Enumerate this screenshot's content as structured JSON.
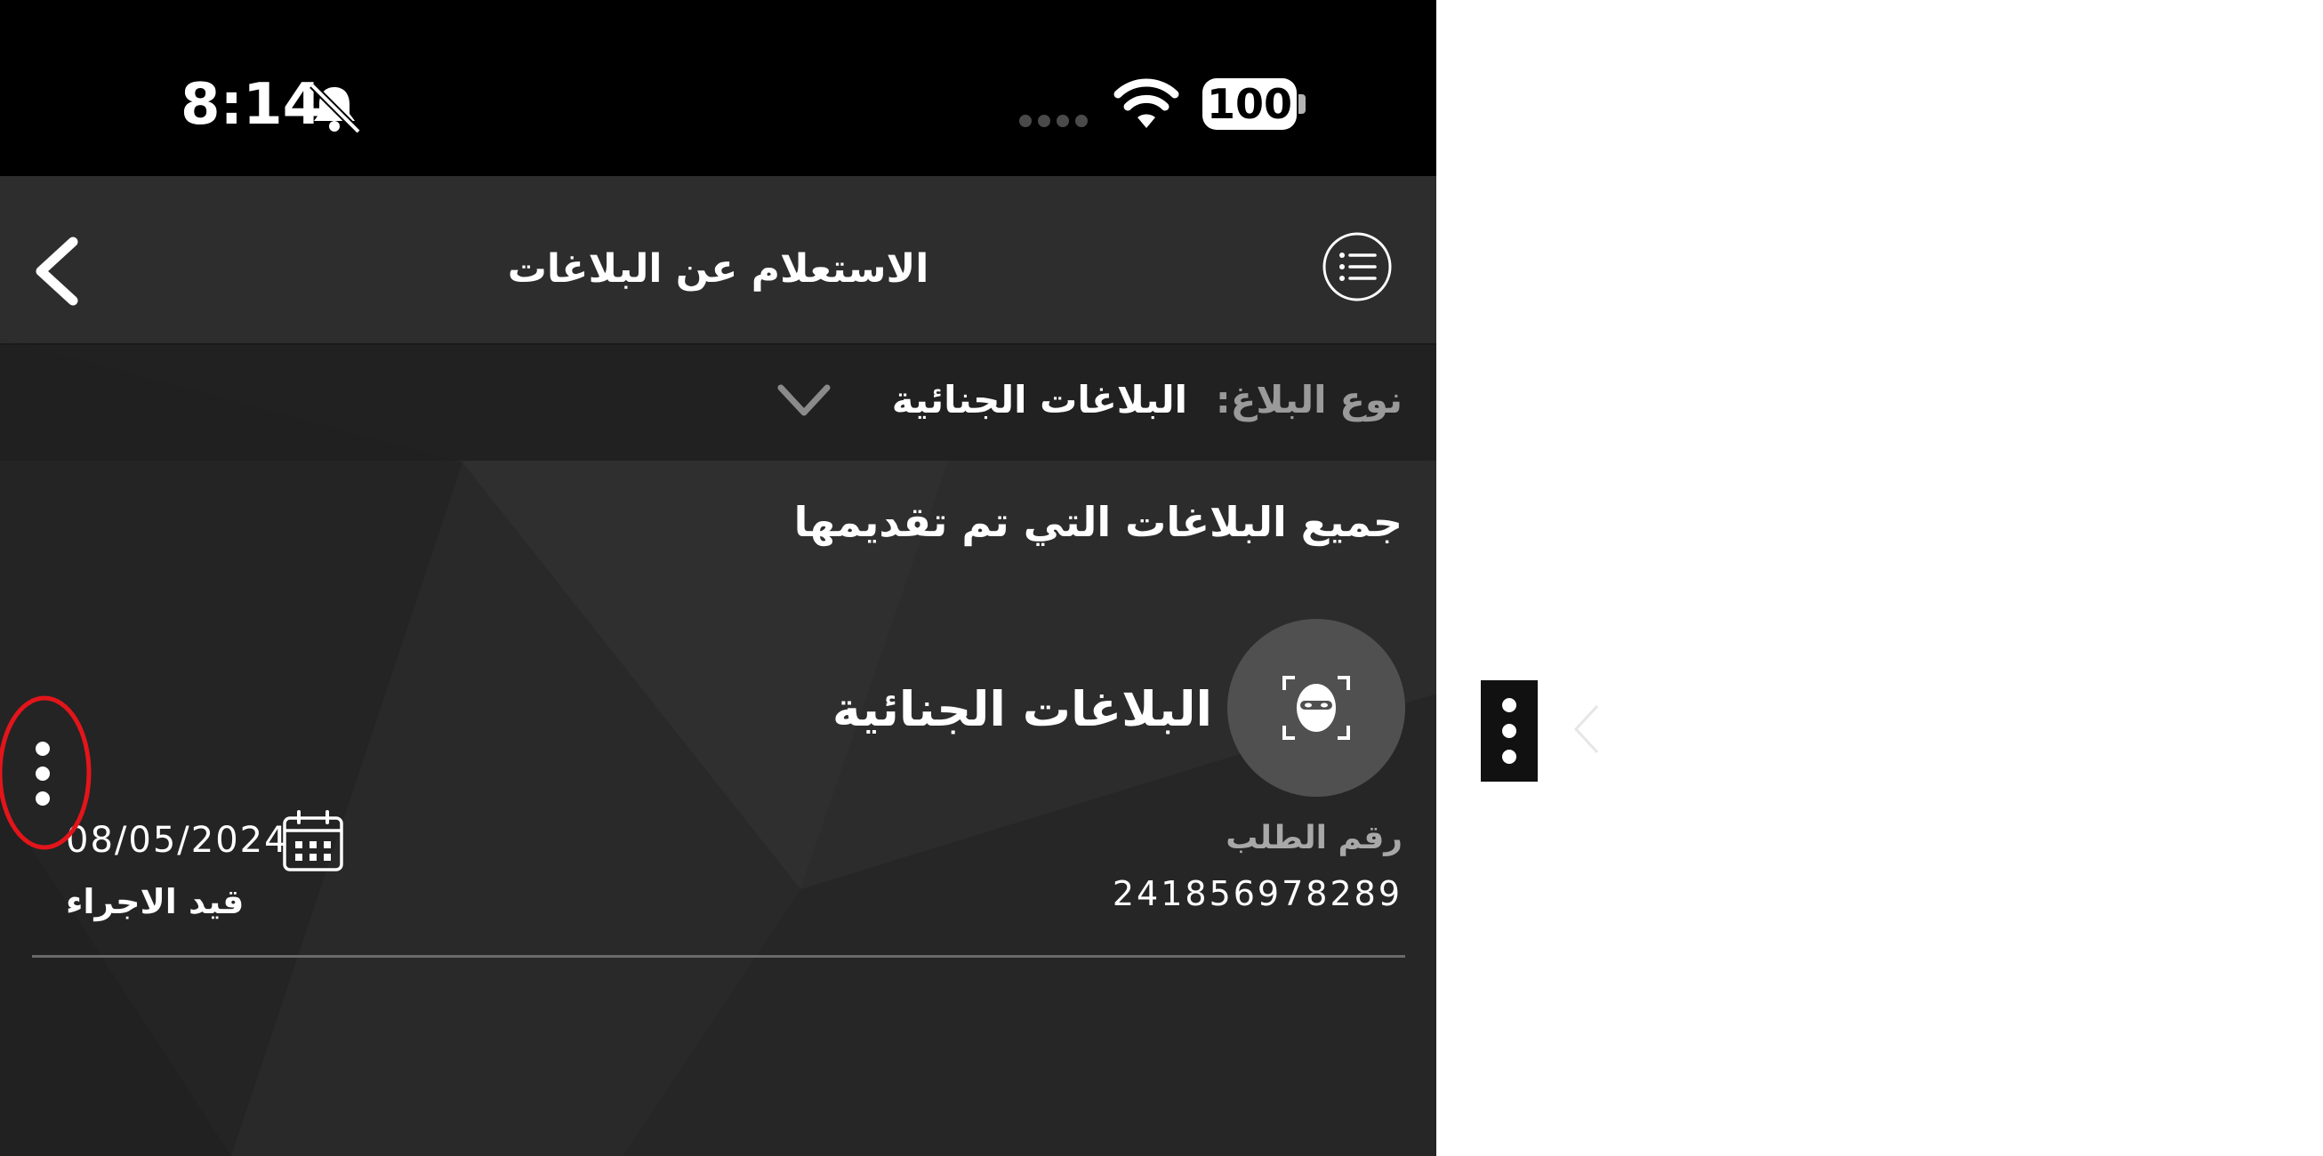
{
  "status_bar": {
    "time": "8:14",
    "battery": "100"
  },
  "header": {
    "title": "الاستعلام عن البلاغات"
  },
  "filter": {
    "label": "نوع البلاغ:",
    "value": "البلاغات الجنائية"
  },
  "section": {
    "title": "جميع البلاغات التي تم تقديمها"
  },
  "reports": [
    {
      "title": "البلاغات الجنائية",
      "request_label": "رقم الطلب",
      "request_number": "241856978289",
      "date": "08/05/2024",
      "status": "قيد الاجراء"
    }
  ],
  "icons": {
    "back": "chevron-left-icon",
    "menu": "list-menu-icon",
    "avatar": "masked-person-icon",
    "calendar": "calendar-icon",
    "more": "vertical-dots-icon",
    "bell": "bell-slash-icon",
    "wifi": "wifi-icon"
  },
  "colors": {
    "background": "#2b2b2b",
    "status_bar": "#000000",
    "highlight": "#e3151a",
    "muted_text": "#9a9a9a"
  }
}
